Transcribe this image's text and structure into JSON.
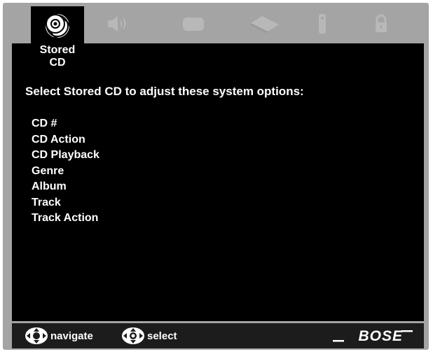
{
  "tabs": [
    {
      "icon": "stored-cd-icon",
      "label": "Stored\nCD",
      "active": true
    },
    {
      "icon": "speaker-icon",
      "label": "",
      "active": false
    },
    {
      "icon": "tv-icon",
      "label": "",
      "active": false
    },
    {
      "icon": "source-device-icon",
      "label": "",
      "active": false
    },
    {
      "icon": "remote-icon",
      "label": "",
      "active": false
    },
    {
      "icon": "lock-icon",
      "label": "",
      "active": false
    }
  ],
  "active_tab": {
    "label_line1": "Stored",
    "label_line2": "CD"
  },
  "main": {
    "heading": "Select Stored CD to adjust these system options:",
    "options": [
      "CD #",
      "CD Action",
      "CD Playback",
      "Genre",
      "Album",
      "Track",
      "Track Action"
    ]
  },
  "footer": {
    "navigate_label": "navigate",
    "select_label": "select",
    "brand": "BOSE"
  },
  "colors": {
    "frame": "#a4a4a4",
    "screen": "#000000",
    "footer": "#1c1c1c",
    "inactive_icon": "#b8b8b8",
    "text": "#ffffff"
  }
}
